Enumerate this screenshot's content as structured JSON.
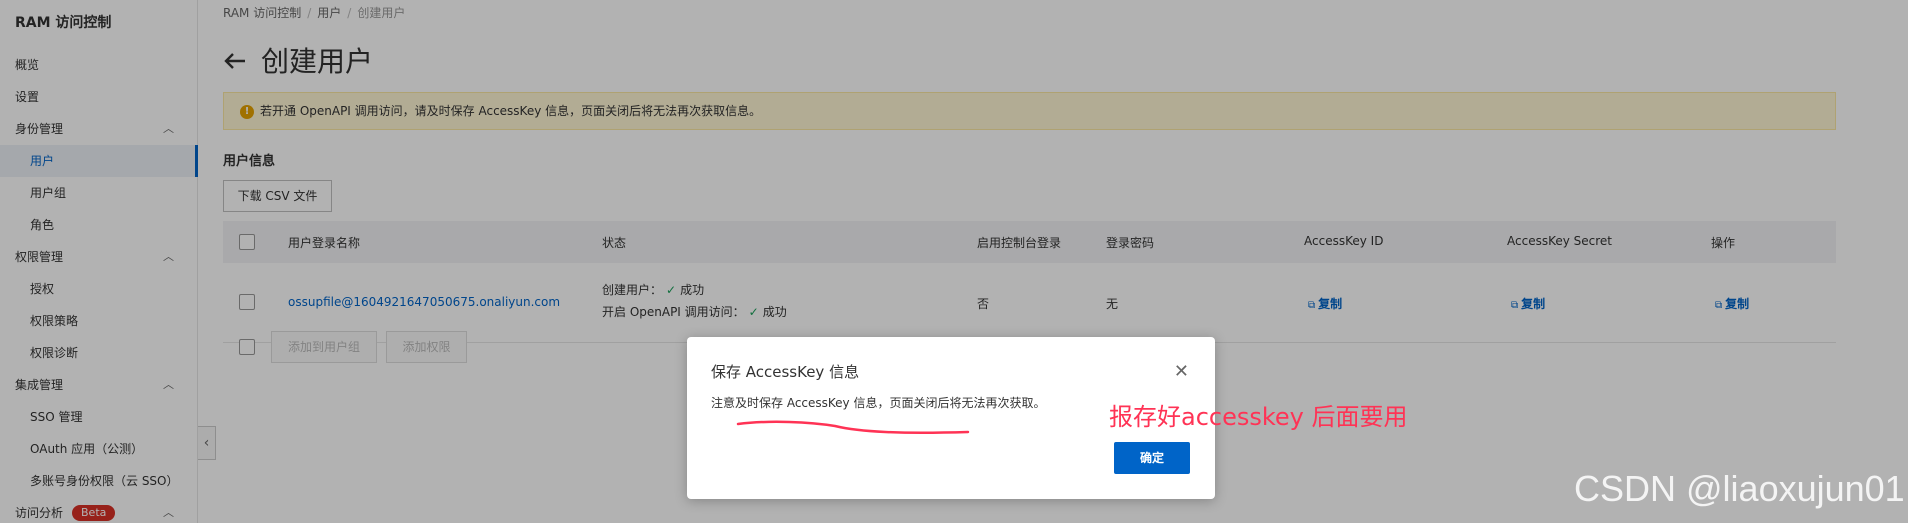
{
  "sidebar": {
    "title": "RAM 访问控制",
    "items": [
      {
        "label": "概览"
      },
      {
        "label": "设置"
      },
      {
        "label": "身份管理"
      },
      {
        "label": "用户"
      },
      {
        "label": "用户组"
      },
      {
        "label": "角色"
      },
      {
        "label": "权限管理"
      },
      {
        "label": "授权"
      },
      {
        "label": "权限策略"
      },
      {
        "label": "权限诊断"
      },
      {
        "label": "集成管理"
      },
      {
        "label": "SSO 管理"
      },
      {
        "label": "OAuth 应用（公测）"
      },
      {
        "label": "多账号身份权限（云 SSO）"
      },
      {
        "label": "访问分析",
        "badge": "Beta"
      }
    ]
  },
  "breadcrumb": [
    "RAM 访问控制",
    "用户",
    "创建用户"
  ],
  "page": {
    "title": "创建用户",
    "alert": "若开通 OpenAPI 调用访问，请及时保存 AccessKey 信息，页面关闭后将无法再次获取信息。",
    "section_title": "用户信息",
    "download_btn": "下载 CSV 文件"
  },
  "table": {
    "headers": [
      "用户登录名称",
      "状态",
      "启用控制台登录",
      "登录密码",
      "AccessKey ID",
      "AccessKey Secret",
      "操作"
    ],
    "row": {
      "login_name": "ossupfile@1604921647050675.onaliyun.com",
      "status_line1_label": "创建用户：",
      "status_line1_value": "成功",
      "status_line2_label": "开启 OpenAPI 调用访问：",
      "status_line2_value": "成功",
      "console_login": "否",
      "password": "无",
      "copy_label": "复制"
    },
    "footer_buttons": [
      "添加到用户组",
      "添加权限"
    ]
  },
  "dialog": {
    "title": "保存 AccessKey 信息",
    "message": "注意及时保存 AccessKey 信息，页面关闭后将无法再次获取。",
    "ok_label": "确定"
  },
  "annotation": "报存好accesskey 后面要用",
  "watermark": "CSDN @liaoxujun01",
  "colors": {
    "primary": "#0064c8",
    "alert_bg": "#fff6d5",
    "annotation": "#ff3355"
  }
}
